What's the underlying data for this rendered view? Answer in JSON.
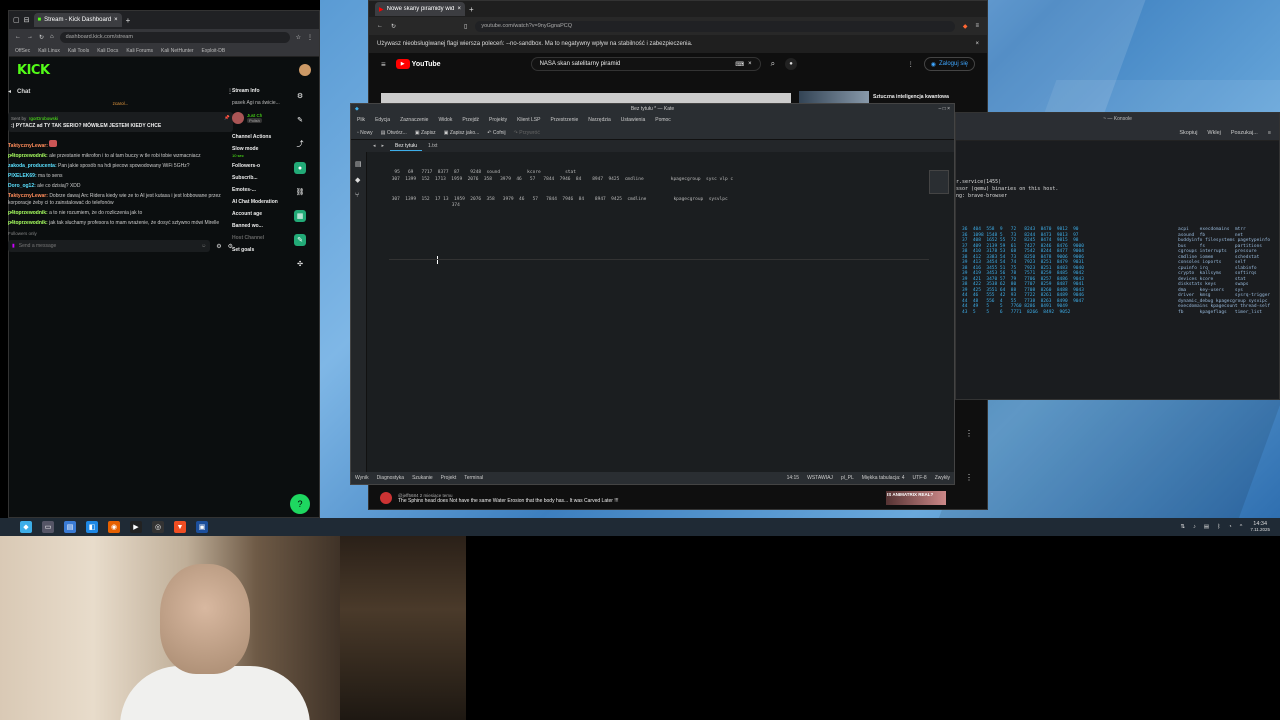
{
  "kick": {
    "tabs": [
      {
        "label": "Stream - Kick Dashboard",
        "active": true
      }
    ],
    "url": "dashboard.kick.com/stream",
    "bookmarks": [
      "OffSec",
      "Kali Linux",
      "Kali Tools",
      "Kali Docs",
      "Kali Forums",
      "Kali NetHunter",
      "Exploit-DB"
    ],
    "logo": "KICK",
    "chat_title": "Chat",
    "pinned_label": "zcarol...",
    "pinned_by": "Sent by",
    "pinned_user": "IgorDrobowski",
    "pinned_text": ":) PYTACZ ad TY TAK SERIO? MÓWIŁEM JESTEM KIEDY CHCE",
    "messages": [
      {
        "user": "TaktycznyLewar:",
        "text": "",
        "color": "u1"
      },
      {
        "user": "p4toprzewodnik:",
        "text": "ale przestanie mikrofon i to al tam buczy w tle robi tobie wzmacniacz",
        "color": "u3"
      },
      {
        "user": "zakoda_producenta:",
        "text": "Pan jakie sposób na hdi piecow spowodowany WiFi 5GHz?",
        "color": "u2"
      },
      {
        "user": "PIXELEK69:",
        "text": "ma to sens",
        "color": "u2"
      },
      {
        "user": "Doro_og12:",
        "text": "ale co dzisiaj? XDD",
        "color": "u2"
      },
      {
        "user": "TaktycznyLewar:",
        "text": "Dobrze dawaj Arc Ridera kiedy wie ze to AI jest kutasa i jest lobbowane przez korporacje żeby ci to zainstalować do telefonów",
        "color": "u1"
      },
      {
        "user": "p4toprzewodnik:",
        "text": "a to nie rozumiem, że do rozliczenia jak to",
        "color": "u3"
      },
      {
        "user": "p4toprzewodnik:",
        "text": "jak tak słuchamy profesora to mam wrażenie, że dosyć sztywno mówi Mirelle",
        "color": "u3"
      }
    ],
    "followers_only": "Followers only",
    "send_placeholder": "Send a message",
    "side": {
      "stream_info": "Stream Info",
      "stream_info_sub": "pasek Agi na świcie...",
      "channel_actions": "Channel Actions",
      "slow_mode": "Slow mode",
      "slow_mode_sub": "10 sec",
      "followers_only": "Followers-o",
      "subscribers": "Subscrib...",
      "emotes": "Emotes-...",
      "ai_chat_mod": "AI Chat Moderation",
      "account_age": "Account age",
      "banned_words": "Banned wo...",
      "host_channel": "Host Channel",
      "set_goals": "Set goals",
      "profile_name": "Just Ch",
      "profile_lang": "Polish"
    }
  },
  "youtube": {
    "tab": "Nowe skany piramidy wido...",
    "url": "youtube.com/watch?v=9nyGgnaPCQ",
    "infobar": "Używasz nieobsługiwanej flagi wiersza poleceń: --no-sandbox. Ma to negatywny wpływ na stabilność i zabezpieczenia.",
    "logo": "YouTube",
    "search": "NASA skan satelitarny piramid",
    "signin": "Zaloguj się",
    "sidebar_title": "Sztuczna inteligencja kwantowa",
    "comment_user": "@jeff5684",
    "comment_time": "2 miesiące temu",
    "comment_text": "The Sphinx head does Not have the same Water Erosion that the body has... It was Carved Later !!!",
    "side_video": "IS ANIMATRIX REAL?"
  },
  "kate": {
    "title": "Bez tytułu * — Kate",
    "menu": [
      "Plik",
      "Edycja",
      "Zaznaczenie",
      "Widok",
      "Przejdź",
      "Projekty",
      "Klient LSP",
      "Przestrzenie",
      "Narzędzia",
      "Ustawienia",
      "Pomoc"
    ],
    "toolbar": [
      "Nowy",
      "Otwórz...",
      "Zapisz",
      "Zapisz jako...",
      "Cofnij",
      "Przywróć"
    ],
    "tabs": [
      "Bez tytułu",
      "1.txt"
    ],
    "code_lines": [
      "  95   69   7717  8377  87    9248  sound          kcore         stat",
      " 307  1399  152  1713  1959  2076  358   3979  46   57   7844  7946  84    8947  9425  cmdline          kpageсgroup  sysc vlp c",
      "",
      " 307  1399  152  17 13  1959  2076  358   3979  46   57   7844  7946  84    8947  9425  cmdline          kpagecgroup  sysvlpc",
      " 374"
    ],
    "status": [
      "Wynik",
      "Diagnostyka",
      "Szukanie",
      "Projekt",
      "Terminal"
    ],
    "status_right": [
      "14:15",
      "WSTAWIAJ",
      "pl_PL",
      "Miękka tabulacja: 4",
      "UTF-8",
      "Zwykły"
    ]
  },
  "konsole": {
    "title": "~ — Konsole",
    "tools": [
      "Skopiuj",
      "Wklej",
      "Poszukaj..."
    ],
    "lines": [
      "r.service(1455)",
      "",
      "ssor (qemu) binaries on this host.",
      "ng: brave-browser"
    ],
    "col1": "36  404  558  9   72   8243  8470  9812  90\n36  1098 1548 5   73   8244  8473  9813  97\n37  408  1652 55  72   8245  8474  9815  98\n37  409  2139 59  61   7427  8246  8476  9000\n38  410  3178 53  68   7542  8244  8477  9004\n38  412  3383 54  73   8250  8478  9006  9006\n39  413  3454 54  74   7923  8251  8479  9031\n38  416  3455 51  75   7923  8251  8483  9040\n39  419  3453 56  78   7571  8259  8485  9042\n39  421  3470 57  79   7706  8257  8486  9043\n38  422  3538 62  80   7707  8259  8487  9041\n39  425  3551 64  88   7708  8260  8488  9043\n44  46   555  42  93   7722  8261  8489  9046\n44  48   556  4   55   7738  8263  8490  9047\n44  49   5    5   7760 8286  8491  9049\n43  5    5    6   7771  8266  8492  9052",
    "col2": "acpi    execdomains  mtrr\nasound  fb           net\nbuddyinfo filesystems pagetypeinfo\nbus     fs           partitions\ncgroups interrupts   pressure\ncmdline iomem        schedstat\nconsoles ioports     self\ncpuinfo irq          slabinfo\ncrypto  kallsyms     softirqs\ndevices kcore        stat\ndiskstats keys       swaps\ndma     key-users    sys\ndriver  kmsg         sysrq-trigger\ndynamic_debug kpagecgroup sysvipc\nexecdomains kpagecount thread-self\nfb      kpageflags   timer_list"
  },
  "taskbar": {
    "time": "14:34",
    "date": "7.11.2025"
  }
}
